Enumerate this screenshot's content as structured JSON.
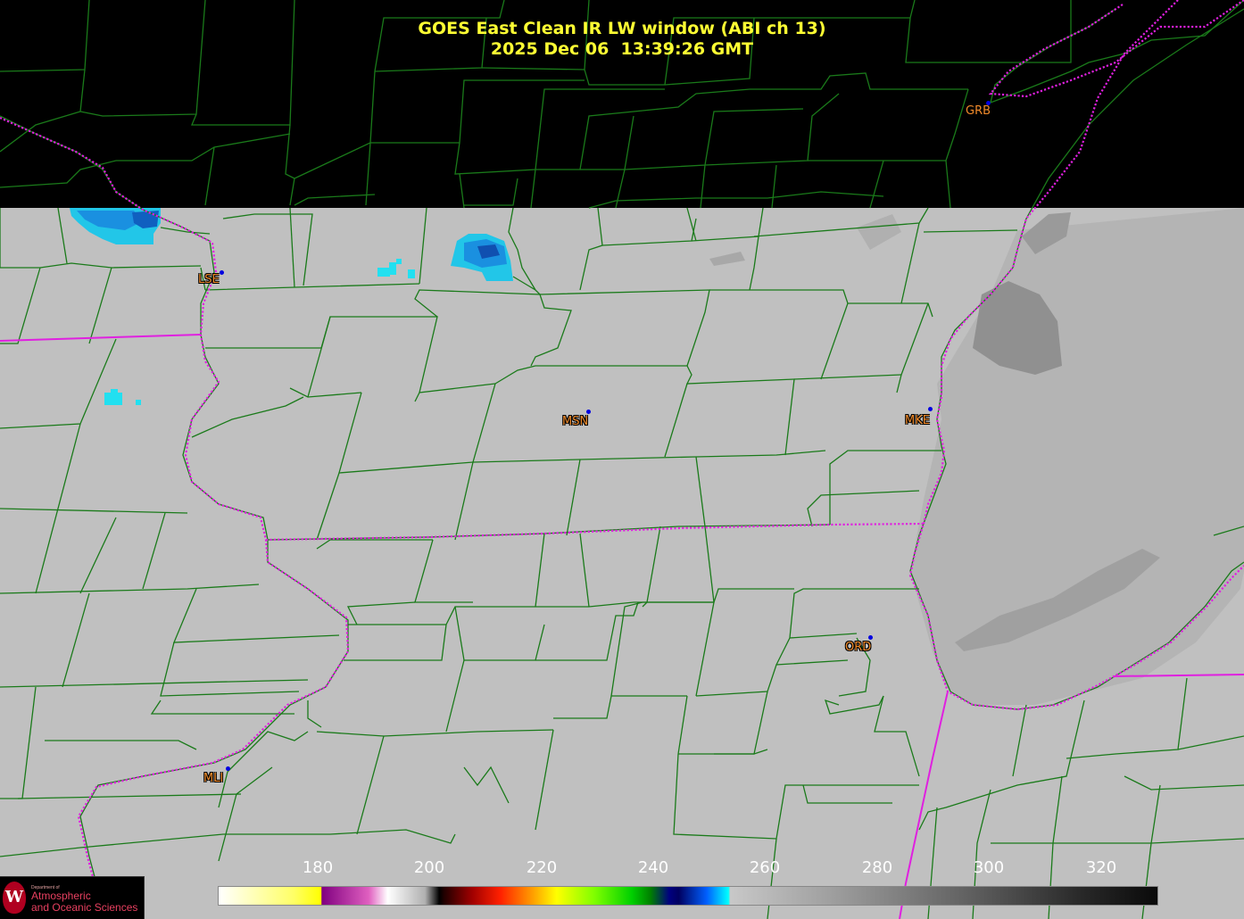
{
  "title": {
    "line1": "GOES East Clean IR LW window (ABI ch 13)",
    "line2": "2025 Dec 06  13:39:26 GMT"
  },
  "stations": [
    {
      "id": "GRB"
    },
    {
      "id": "LSE"
    },
    {
      "id": "MSN"
    },
    {
      "id": "MKE"
    },
    {
      "id": "ORD"
    },
    {
      "id": "MLI"
    }
  ],
  "colorbar": {
    "ticks": [
      "180",
      "200",
      "220",
      "240",
      "260",
      "280",
      "300",
      "320"
    ],
    "colormap": "IR brightness temperature enhancement"
  },
  "logo": {
    "dept_small": "Department of",
    "line1": "Atmospheric",
    "line2": "and Oceanic Sciences",
    "crest_letter": "W"
  },
  "colors": {
    "title": "#ffff33",
    "county_lines": "#1a7a1a",
    "state_borders": "#e020e0",
    "station_label": "#f08a2a",
    "station_marker": "#0000e0",
    "clear_sky_gray": "#c0c0c0",
    "no_data": "#000000"
  }
}
